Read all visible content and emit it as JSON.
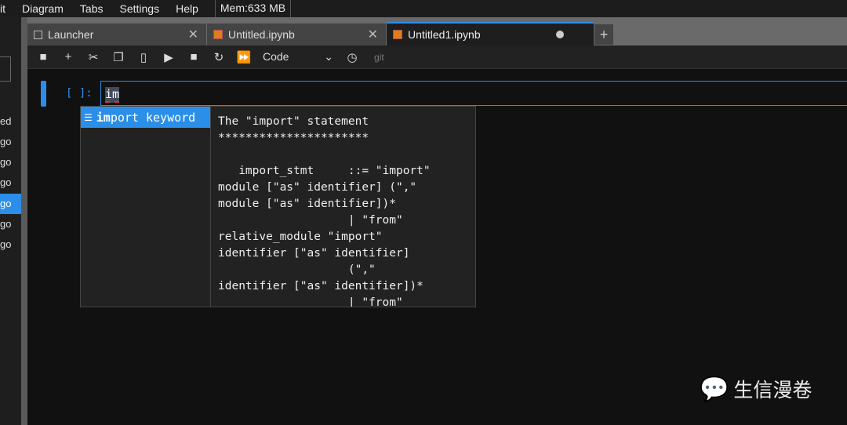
{
  "menubar": {
    "items": [
      "it",
      "Diagram",
      "Tabs",
      "Settings",
      "Help"
    ],
    "mem": "Mem:633 MB"
  },
  "sidebar": {
    "items": [
      "ed",
      "go",
      "go",
      "go",
      "go",
      "go",
      "go"
    ],
    "selected_index": 4
  },
  "tabs": [
    {
      "label": "Launcher"
    },
    {
      "label": "Untitled.ipynb"
    },
    {
      "label": "Untitled1.ipynb",
      "unsaved": true
    }
  ],
  "toolbar": {
    "cell_type": "Code",
    "git": "git"
  },
  "cell": {
    "prompt": "[ ]:",
    "code": "im"
  },
  "completer": {
    "match": "im",
    "rest": "port",
    "type": "keyword",
    "doc": "The \"import\" statement\n**********************\n\n   import_stmt     ::= \"import\"\nmodule [\"as\" identifier] (\",\"\nmodule [\"as\" identifier])*\n                   | \"from\"\nrelative_module \"import\"\nidentifier [\"as\" identifier]\n                   (\",\"\nidentifier [\"as\" identifier])*\n                   | \"from\""
  },
  "watermark": "生信漫卷"
}
